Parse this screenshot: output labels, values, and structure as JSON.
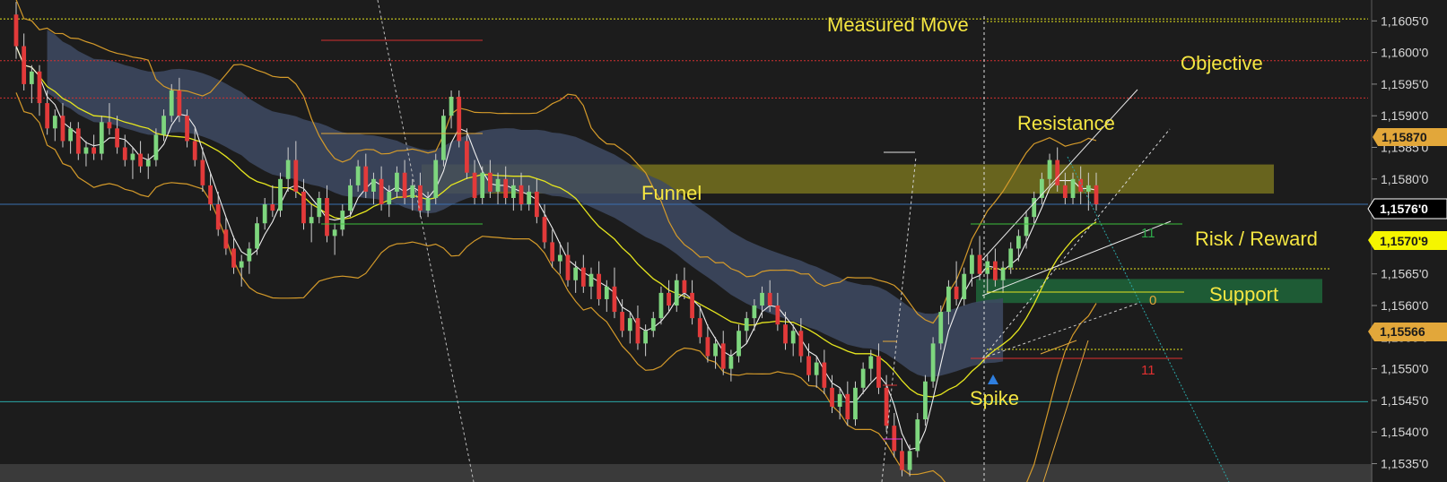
{
  "chart_data": {
    "type": "candlestick",
    "instrument_hint": "",
    "y_axis": {
      "ylim": [
        1.15321,
        1.16083
      ],
      "ticks": [
        "1,1535'0",
        "1,1540'0",
        "1,1545'0",
        "1,1550'0",
        "1,1555'0",
        "1,1560'0",
        "1,1565'0",
        "1,1570'0",
        "1,1575'0",
        "1,1580'0",
        "1,1585'0",
        "1,1590'0",
        "1,1595'0",
        "1,1600'0",
        "1,1605'0"
      ],
      "tick_values": [
        1.1535,
        1.154,
        1.1545,
        1.155,
        1.1555,
        1.156,
        1.1565,
        1.157,
        1.1575,
        1.158,
        1.1585,
        1.159,
        1.1595,
        1.16,
        1.1605
      ]
    },
    "price_badges": [
      {
        "label": "1,15870",
        "value": 1.1587,
        "bg": "#e2a73a",
        "fg": "#1a1a1a"
      },
      {
        "label": "1,1576'0",
        "value": 1.1576,
        "bg": "#000000",
        "fg": "#ffffff",
        "border": "#ffffff"
      },
      {
        "label": "1,1570'9",
        "value": 1.15709,
        "bg": "#f5f500",
        "fg": "#1a1a1a"
      },
      {
        "label": "1,15566",
        "value": 1.15566,
        "bg": "#e2a73a",
        "fg": "#1a1a1a"
      }
    ],
    "annotations": [
      {
        "text": "Measured Move"
      },
      {
        "text": "Objective"
      },
      {
        "text": "Resistance"
      },
      {
        "text": "Funnel"
      },
      {
        "text": "Risk / Reward"
      },
      {
        "text": "Support"
      },
      {
        "text": "Spike"
      }
    ],
    "counts": [
      {
        "text": "11",
        "color": "#2ea84a"
      },
      {
        "text": "0",
        "color": "#e2a73a"
      },
      {
        "text": "11",
        "color": "#e03030"
      }
    ],
    "horizontal_levels": [
      {
        "value": 1.16053,
        "color": "#e6e61e",
        "style": "dotted"
      },
      {
        "value": 1.15987,
        "color": "#d43030",
        "style": "dotted"
      },
      {
        "value": 1.15928,
        "color": "#d43030",
        "style": "dotted"
      },
      {
        "value": 1.1576,
        "color": "#3a6fb0",
        "style": "solid"
      },
      {
        "value": 1.15448,
        "color": "#2aa7a7",
        "style": "solid"
      }
    ],
    "zones": [
      {
        "name": "funnel",
        "from": 1.15777,
        "to": 1.15823,
        "color": "#a8a020"
      },
      {
        "name": "support",
        "from": 1.15604,
        "to": 1.15642,
        "color": "#1f6b3c"
      }
    ],
    "colors": {
      "up": "#7ed67e",
      "down": "#e23a3a",
      "cloud": "#3e4a63",
      "bollinger": "#d49a2a",
      "ma_yellow": "#e6e61e",
      "ma_white": "#f0f0f0"
    },
    "candles": [
      [
        1.1606,
        1.1608,
        1.1599,
        1.1601
      ],
      [
        1.1601,
        1.1603,
        1.1594,
        1.1595
      ],
      [
        1.1595,
        1.1598,
        1.1592,
        1.1597
      ],
      [
        1.1597,
        1.1598,
        1.159,
        1.1592
      ],
      [
        1.1592,
        1.1594,
        1.1587,
        1.1588
      ],
      [
        1.1588,
        1.1591,
        1.1586,
        1.159
      ],
      [
        1.159,
        1.1592,
        1.1585,
        1.1586
      ],
      [
        1.1586,
        1.1589,
        1.1584,
        1.1588
      ],
      [
        1.1588,
        1.1589,
        1.1583,
        1.1584
      ],
      [
        1.1584,
        1.1586,
        1.1582,
        1.1585
      ],
      [
        1.1585,
        1.1587,
        1.1583,
        1.1584
      ],
      [
        1.1584,
        1.159,
        1.1583,
        1.1589
      ],
      [
        1.1589,
        1.1592,
        1.1587,
        1.1588
      ],
      [
        1.1588,
        1.159,
        1.1584,
        1.1585
      ],
      [
        1.1585,
        1.1587,
        1.1582,
        1.1583
      ],
      [
        1.1583,
        1.1585,
        1.158,
        1.1584
      ],
      [
        1.1584,
        1.1586,
        1.1581,
        1.1582
      ],
      [
        1.1582,
        1.1584,
        1.158,
        1.1583
      ],
      [
        1.1583,
        1.1588,
        1.1582,
        1.1587
      ],
      [
        1.1587,
        1.1591,
        1.1586,
        1.159
      ],
      [
        1.159,
        1.1595,
        1.1589,
        1.1594
      ],
      [
        1.1594,
        1.1596,
        1.1589,
        1.159
      ],
      [
        1.159,
        1.1591,
        1.1585,
        1.1586
      ],
      [
        1.1586,
        1.1588,
        1.1582,
        1.1583
      ],
      [
        1.1583,
        1.1585,
        1.1578,
        1.1579
      ],
      [
        1.1579,
        1.1581,
        1.1575,
        1.1576
      ],
      [
        1.1576,
        1.1578,
        1.1571,
        1.1572
      ],
      [
        1.1572,
        1.1574,
        1.1568,
        1.1569
      ],
      [
        1.1569,
        1.1571,
        1.1565,
        1.1566
      ],
      [
        1.1566,
        1.1568,
        1.1563,
        1.1567
      ],
      [
        1.1567,
        1.157,
        1.1565,
        1.1569
      ],
      [
        1.1569,
        1.1574,
        1.1568,
        1.1573
      ],
      [
        1.1573,
        1.1577,
        1.1572,
        1.1576
      ],
      [
        1.1576,
        1.1579,
        1.1574,
        1.1575
      ],
      [
        1.1575,
        1.1581,
        1.1574,
        1.158
      ],
      [
        1.158,
        1.1585,
        1.1578,
        1.1583
      ],
      [
        1.1583,
        1.1586,
        1.1577,
        1.1578
      ],
      [
        1.1578,
        1.158,
        1.1572,
        1.1573
      ],
      [
        1.1573,
        1.1576,
        1.157,
        1.1574
      ],
      [
        1.1574,
        1.1578,
        1.1573,
        1.1577
      ],
      [
        1.1577,
        1.1579,
        1.157,
        1.1571
      ],
      [
        1.1571,
        1.1573,
        1.1568,
        1.1572
      ],
      [
        1.1572,
        1.1576,
        1.1571,
        1.1575
      ],
      [
        1.1575,
        1.158,
        1.1574,
        1.1579
      ],
      [
        1.1579,
        1.1583,
        1.1578,
        1.1582
      ],
      [
        1.1582,
        1.1584,
        1.1577,
        1.1578
      ],
      [
        1.1578,
        1.1581,
        1.1576,
        1.158
      ],
      [
        1.158,
        1.1582,
        1.1575,
        1.1576
      ],
      [
        1.1576,
        1.1579,
        1.1574,
        1.1578
      ],
      [
        1.1578,
        1.1582,
        1.1577,
        1.1581
      ],
      [
        1.1581,
        1.1583,
        1.1576,
        1.1577
      ],
      [
        1.1577,
        1.158,
        1.1575,
        1.1579
      ],
      [
        1.1579,
        1.1581,
        1.1574,
        1.1575
      ],
      [
        1.1575,
        1.1578,
        1.1574,
        1.1577
      ],
      [
        1.1577,
        1.1584,
        1.1576,
        1.1583
      ],
      [
        1.1583,
        1.1591,
        1.1582,
        1.159
      ],
      [
        1.159,
        1.1594,
        1.1588,
        1.1593
      ],
      [
        1.1593,
        1.1594,
        1.1585,
        1.1586
      ],
      [
        1.1586,
        1.1588,
        1.158,
        1.1581
      ],
      [
        1.1581,
        1.1583,
        1.1576,
        1.1577
      ],
      [
        1.1577,
        1.1582,
        1.1576,
        1.1581
      ],
      [
        1.1581,
        1.1583,
        1.1577,
        1.1578
      ],
      [
        1.1578,
        1.1581,
        1.1576,
        1.158
      ],
      [
        1.158,
        1.1582,
        1.1576,
        1.1577
      ],
      [
        1.1577,
        1.158,
        1.1575,
        1.1579
      ],
      [
        1.1579,
        1.1581,
        1.1575,
        1.1576
      ],
      [
        1.1576,
        1.1579,
        1.1575,
        1.1578
      ],
      [
        1.1578,
        1.158,
        1.1573,
        1.1574
      ],
      [
        1.1574,
        1.1576,
        1.1569,
        1.157
      ],
      [
        1.157,
        1.1572,
        1.1566,
        1.1567
      ],
      [
        1.1567,
        1.157,
        1.1565,
        1.1568
      ],
      [
        1.1568,
        1.157,
        1.1563,
        1.1564
      ],
      [
        1.1564,
        1.1567,
        1.1562,
        1.1566
      ],
      [
        1.1566,
        1.1568,
        1.1562,
        1.1563
      ],
      [
        1.1563,
        1.1566,
        1.1561,
        1.1565
      ],
      [
        1.1565,
        1.1567,
        1.156,
        1.1561
      ],
      [
        1.1561,
        1.1564,
        1.1559,
        1.1563
      ],
      [
        1.1563,
        1.1566,
        1.1558,
        1.1559
      ],
      [
        1.1559,
        1.1561,
        1.1555,
        1.1556
      ],
      [
        1.1556,
        1.1559,
        1.1554,
        1.1558
      ],
      [
        1.1558,
        1.156,
        1.1553,
        1.1554
      ],
      [
        1.1554,
        1.1557,
        1.1552,
        1.1556
      ],
      [
        1.1556,
        1.1559,
        1.1555,
        1.1558
      ],
      [
        1.1558,
        1.1563,
        1.1557,
        1.1562
      ],
      [
        1.1562,
        1.1564,
        1.1559,
        1.156
      ],
      [
        1.156,
        1.1565,
        1.1559,
        1.1564
      ],
      [
        1.1564,
        1.1566,
        1.1561,
        1.1562
      ],
      [
        1.1562,
        1.1564,
        1.1557,
        1.1558
      ],
      [
        1.1558,
        1.156,
        1.1554,
        1.1555
      ],
      [
        1.1555,
        1.1557,
        1.1551,
        1.1552
      ],
      [
        1.1552,
        1.1555,
        1.155,
        1.1554
      ],
      [
        1.1554,
        1.1556,
        1.1549,
        1.155
      ],
      [
        1.155,
        1.1553,
        1.1548,
        1.1552
      ],
      [
        1.1552,
        1.1557,
        1.1551,
        1.1556
      ],
      [
        1.1556,
        1.1559,
        1.1554,
        1.1558
      ],
      [
        1.1558,
        1.1561,
        1.1556,
        1.156
      ],
      [
        1.156,
        1.1563,
        1.1558,
        1.1562
      ],
      [
        1.1562,
        1.1564,
        1.1559,
        1.156
      ],
      [
        1.156,
        1.1562,
        1.1556,
        1.1557
      ],
      [
        1.1557,
        1.1559,
        1.1553,
        1.1554
      ],
      [
        1.1554,
        1.1557,
        1.1552,
        1.1556
      ],
      [
        1.1556,
        1.1558,
        1.1551,
        1.1552
      ],
      [
        1.1552,
        1.1554,
        1.1548,
        1.1549
      ],
      [
        1.1549,
        1.1552,
        1.1547,
        1.1551
      ],
      [
        1.1551,
        1.1553,
        1.1546,
        1.1547
      ],
      [
        1.1547,
        1.1549,
        1.1543,
        1.1544
      ],
      [
        1.1544,
        1.1547,
        1.1542,
        1.1546
      ],
      [
        1.1546,
        1.1548,
        1.1541,
        1.1542
      ],
      [
        1.1542,
        1.1548,
        1.1541,
        1.1547
      ],
      [
        1.1547,
        1.1551,
        1.1546,
        1.155
      ],
      [
        1.155,
        1.1553,
        1.1548,
        1.1552
      ],
      [
        1.1552,
        1.1554,
        1.1546,
        1.1547
      ],
      [
        1.1547,
        1.1549,
        1.154,
        1.1541
      ],
      [
        1.1541,
        1.1543,
        1.1536,
        1.1537
      ],
      [
        1.1537,
        1.1539,
        1.1533,
        1.1534
      ],
      [
        1.1534,
        1.1538,
        1.1533,
        1.1537
      ],
      [
        1.1537,
        1.1543,
        1.1536,
        1.1542
      ],
      [
        1.1542,
        1.1549,
        1.1541,
        1.1548
      ],
      [
        1.1548,
        1.1555,
        1.1547,
        1.1554
      ],
      [
        1.1554,
        1.156,
        1.1553,
        1.1559
      ],
      [
        1.1559,
        1.1564,
        1.1557,
        1.1563
      ],
      [
        1.1563,
        1.1567,
        1.156,
        1.1561
      ],
      [
        1.1561,
        1.1566,
        1.156,
        1.1565
      ],
      [
        1.1565,
        1.1569,
        1.1563,
        1.1568
      ],
      [
        1.1568,
        1.1571,
        1.1564,
        1.1565
      ],
      [
        1.1565,
        1.1568,
        1.1562,
        1.1567
      ],
      [
        1.1567,
        1.1569,
        1.1563,
        1.1564
      ],
      [
        1.1564,
        1.1567,
        1.1562,
        1.1566
      ],
      [
        1.1566,
        1.157,
        1.1565,
        1.1569
      ],
      [
        1.1569,
        1.1572,
        1.1567,
        1.1571
      ],
      [
        1.1571,
        1.1575,
        1.1569,
        1.1574
      ],
      [
        1.1574,
        1.1578,
        1.1573,
        1.1577
      ],
      [
        1.1577,
        1.1581,
        1.1576,
        1.158
      ],
      [
        1.158,
        1.1584,
        1.1579,
        1.1583
      ],
      [
        1.1583,
        1.1585,
        1.1578,
        1.1579
      ],
      [
        1.1579,
        1.1581,
        1.1576,
        1.1577
      ],
      [
        1.1577,
        1.1581,
        1.1576,
        1.158
      ],
      [
        1.158,
        1.1582,
        1.1576,
        1.1578
      ],
      [
        1.1578,
        1.1581,
        1.1575,
        1.1579
      ],
      [
        1.1579,
        1.1581,
        1.1575,
        1.1576
      ]
    ]
  }
}
